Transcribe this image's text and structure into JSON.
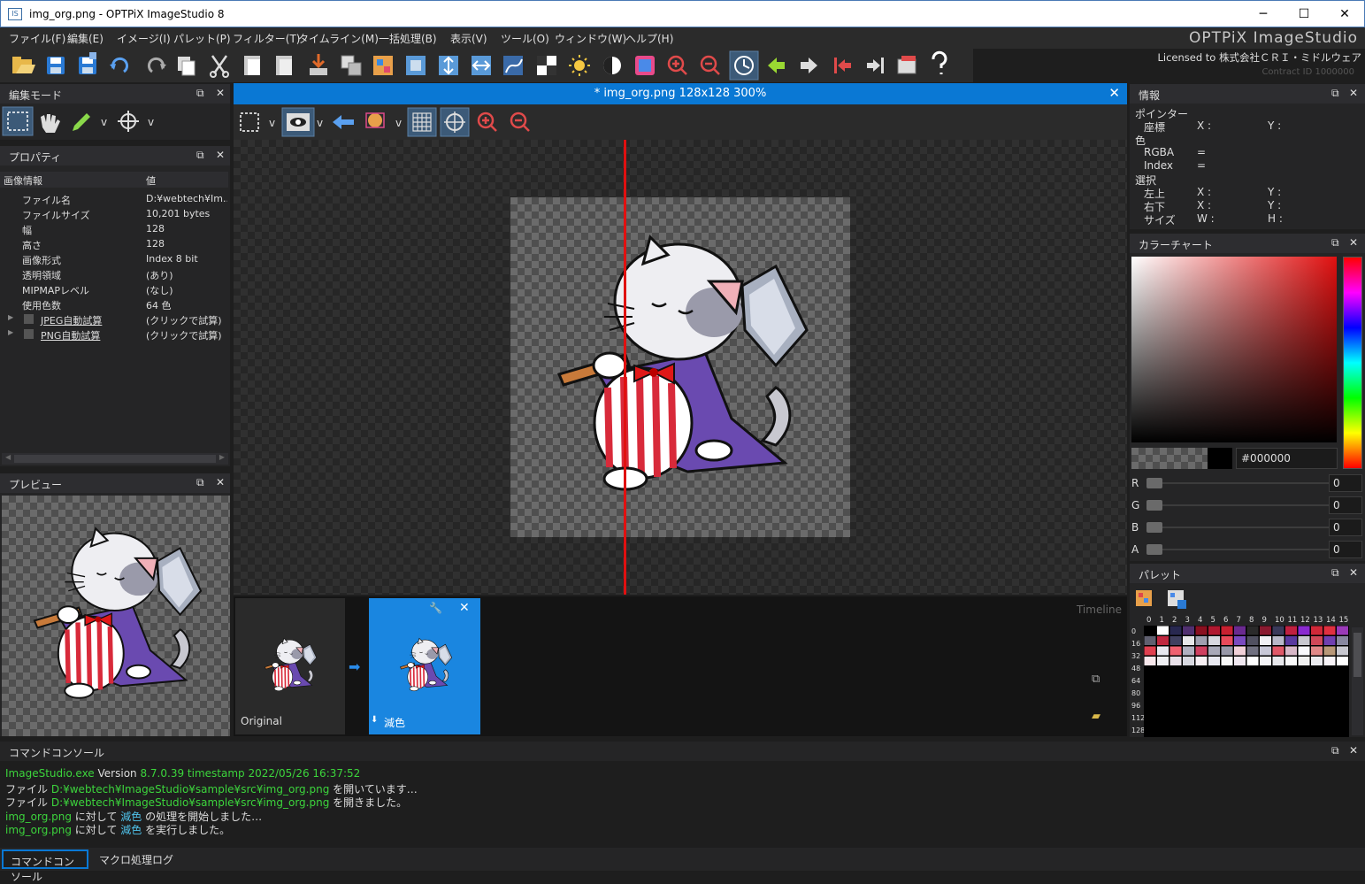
{
  "window": {
    "title": "img_org.png - OPTPiX ImageStudio 8",
    "minimize": "─",
    "maximize": "☐",
    "close": "✕"
  },
  "menu": [
    "ファイル(F)",
    "編集(E)",
    "イメージ(I)",
    "パレット(P)",
    "フィルター(T)",
    "タイムライン(M)",
    "一括処理(B)",
    "表示(V)",
    "ツール(O)",
    "ウィンドウ(W)",
    "ヘルプ(H)"
  ],
  "brand": "OPTPiX ImageStudio",
  "license": "Licensed to 株式会社ＣＲＩ・ミドルウェア",
  "serial": "Contract ID 1000000",
  "toolbar_icons": [
    "open-icon",
    "save-icon",
    "save-as-icon",
    "undo-icon",
    "redo-icon",
    "copy-icon",
    "cut-icon",
    "paste-icon",
    "paste-new-icon",
    "import-icon",
    "layers-icon",
    "palette-edit-icon",
    "resize-icon",
    "flip-v-icon",
    "flip-h-icon",
    "curve-icon",
    "checker-icon",
    "brightness-icon",
    "contrast-icon",
    "color-reduce-icon",
    "zoom-in-icon",
    "zoom-out-icon",
    "history-icon",
    "arrow-left-icon",
    "arrow-right-icon",
    "first-icon",
    "last-icon",
    "batch-icon",
    "help-icon"
  ],
  "edit_mode": {
    "title": "編集モード"
  },
  "properties": {
    "title": "プロパティ",
    "col_key": "画像情報",
    "col_val": "値",
    "rows": [
      {
        "k": "ファイル名",
        "v": "D:¥webtech¥Im..."
      },
      {
        "k": "ファイルサイズ",
        "v": "10,201 bytes"
      },
      {
        "k": "幅",
        "v": "128"
      },
      {
        "k": "高さ",
        "v": "128"
      },
      {
        "k": "画像形式",
        "v": "Index 8 bit"
      },
      {
        "k": "透明領域",
        "v": "(あり)"
      },
      {
        "k": "MIPMAPレベル",
        "v": "(なし)"
      },
      {
        "k": "使用色数",
        "v": "64 色"
      },
      {
        "k": "JPEG自動試算",
        "v": "(クリックで試算)"
      },
      {
        "k": "PNG自動試算",
        "v": "(クリックで試算)"
      }
    ]
  },
  "preview": {
    "title": "プレビュー"
  },
  "document": {
    "tab_title": "* img_org.png 128x128 300%"
  },
  "timeline": {
    "label": "Timeline",
    "original_label": "Original",
    "reduce_label": "減色"
  },
  "info": {
    "title": "情報",
    "pointer": "ポインター",
    "coords": "座標",
    "x": "X :",
    "y": "Y :",
    "color": "色",
    "rgba": "RGBA",
    "index": "Index",
    "eq": "=",
    "selection": "選択",
    "top_left": "左上",
    "bottom_right": "右下",
    "size": "サイズ",
    "w": "W :",
    "h": "H :"
  },
  "color_chart": {
    "title": "カラーチャート",
    "hex": "#000000",
    "r_label": "R",
    "g_label": "G",
    "b_label": "B",
    "a_label": "A",
    "r": "0",
    "g": "0",
    "b": "0",
    "a": "0"
  },
  "palette": {
    "title": "パレット",
    "col_headers": [
      "0",
      "1",
      "2",
      "3",
      "4",
      "5",
      "6",
      "7",
      "8",
      "9",
      "10",
      "11",
      "12",
      "13",
      "14",
      "15"
    ],
    "row_headers": [
      "0",
      "16",
      "32",
      "48",
      "64",
      "80",
      "96",
      "112",
      "128"
    ]
  },
  "console": {
    "title": "コマンドコンソール",
    "lines": [
      [
        {
          "t": "ImageStudio.exe",
          "c": "g"
        },
        {
          "t": " Version ",
          "c": ""
        },
        {
          "t": "8.7.0.39 timestamp 2022/05/26 16:37:52",
          "c": "g"
        }
      ],
      [
        {
          "t": "ファイル ",
          "c": ""
        },
        {
          "t": "D:¥webtech¥ImageStudio¥sample¥src¥img_org.png",
          "c": "g"
        },
        {
          "t": " を開いています…",
          "c": ""
        }
      ],
      [
        {
          "t": "ファイル ",
          "c": ""
        },
        {
          "t": "D:¥webtech¥ImageStudio¥sample¥src¥img_org.png",
          "c": "g"
        },
        {
          "t": " を開きました。",
          "c": ""
        }
      ],
      [
        {
          "t": "img_org.png",
          "c": "g"
        },
        {
          "t": " に対して ",
          "c": ""
        },
        {
          "t": "減色",
          "c": "c"
        },
        {
          "t": " の処理を開始しました…",
          "c": ""
        }
      ],
      [
        {
          "t": "img_org.png",
          "c": "g"
        },
        {
          "t": " に対して ",
          "c": ""
        },
        {
          "t": "減色",
          "c": "c"
        },
        {
          "t": " を実行しました。",
          "c": ""
        }
      ]
    ],
    "tabs": [
      "コマンドコンソール",
      "マクロ処理ログ"
    ]
  },
  "colors": {
    "accent": "#0a78d4",
    "red_line": "#e01010",
    "green_text": "#3cd43c",
    "cyan_text": "#4fc1e9"
  }
}
